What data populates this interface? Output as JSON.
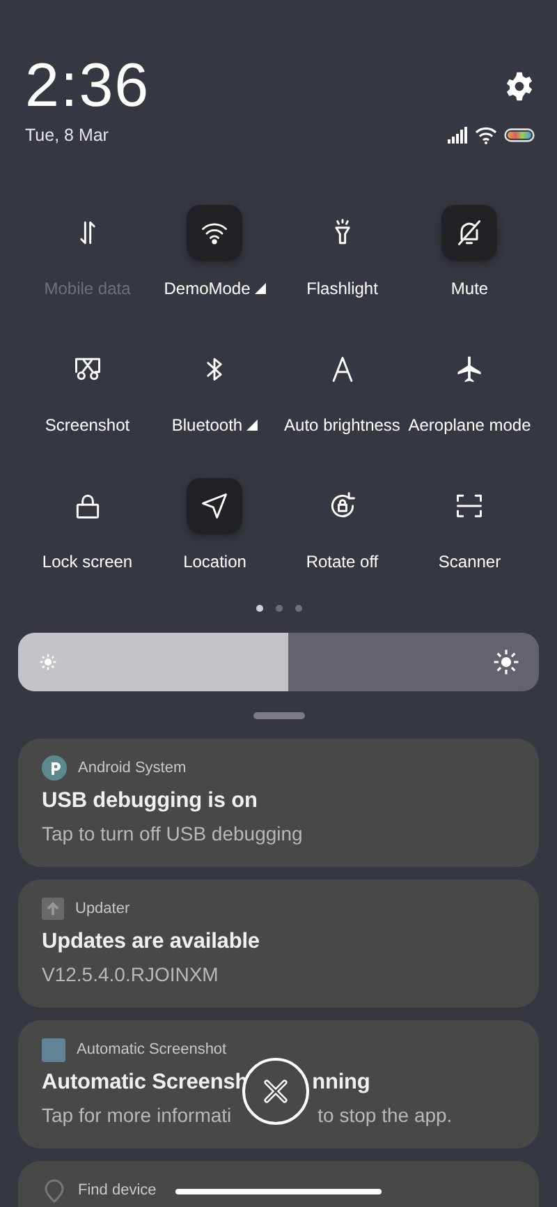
{
  "clock": {
    "time": "2:36",
    "date": "Tue, 8 Mar"
  },
  "tiles": [
    {
      "label": "Mobile data",
      "active": false,
      "disabled": true,
      "menu": false
    },
    {
      "label": "DemoMode",
      "active": true,
      "disabled": false,
      "menu": true
    },
    {
      "label": "Flashlight",
      "active": false,
      "disabled": false,
      "menu": false
    },
    {
      "label": "Mute",
      "active": true,
      "disabled": false,
      "menu": false
    },
    {
      "label": "Screenshot",
      "active": false,
      "disabled": false,
      "menu": false
    },
    {
      "label": "Bluetooth",
      "active": false,
      "disabled": false,
      "menu": true
    },
    {
      "label": "Auto brightness",
      "active": false,
      "disabled": false,
      "menu": false
    },
    {
      "label": "Aeroplane mode",
      "active": false,
      "disabled": false,
      "menu": false
    },
    {
      "label": "Lock screen",
      "active": false,
      "disabled": false,
      "menu": false
    },
    {
      "label": "Location",
      "active": true,
      "disabled": false,
      "menu": false
    },
    {
      "label": "Rotate off",
      "active": false,
      "disabled": false,
      "menu": false
    },
    {
      "label": "Scanner",
      "active": false,
      "disabled": false,
      "menu": false
    }
  ],
  "pages": [
    {
      "selected": true
    },
    {
      "selected": false
    },
    {
      "selected": false
    }
  ],
  "brightness": {
    "level": 0.52
  },
  "notifications": [
    {
      "app": "Android System",
      "title": [
        "USB debugging is on"
      ],
      "body": [
        "Tap to turn off USB debugging"
      ]
    },
    {
      "app": "Updater",
      "title": [
        "Updates are available"
      ],
      "body": [
        "V12.5.4.0.RJOINXM"
      ]
    },
    {
      "app": "Automatic Screenshot",
      "title": [
        "Automatic Screensh",
        "nning"
      ],
      "body": [
        "Tap for more informati",
        "to stop the app."
      ]
    },
    {
      "app": "Find device"
    }
  ]
}
